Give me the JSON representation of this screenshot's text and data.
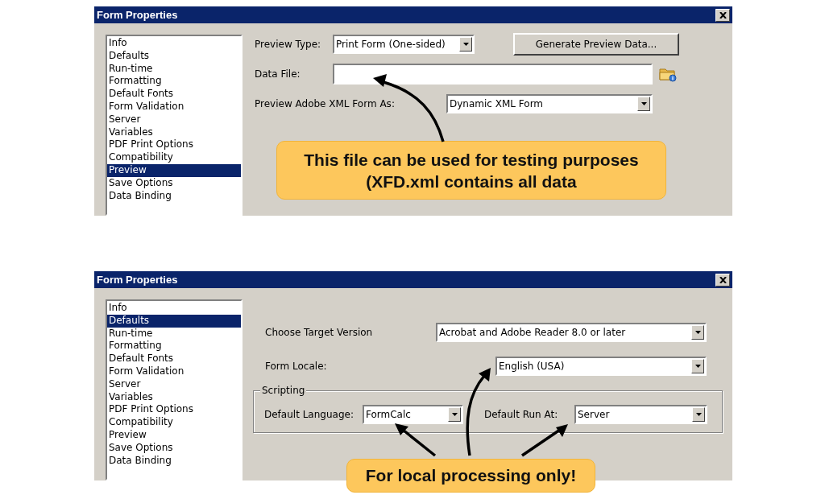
{
  "dialogs": [
    {
      "title": "Form Properties",
      "categories": [
        {
          "label": "Info",
          "selected": false
        },
        {
          "label": "Defaults",
          "selected": false
        },
        {
          "label": "Run-time",
          "selected": false
        },
        {
          "label": "Formatting",
          "selected": false
        },
        {
          "label": "Default Fonts",
          "selected": false
        },
        {
          "label": "Form Validation",
          "selected": false
        },
        {
          "label": "Server",
          "selected": false
        },
        {
          "label": "Variables",
          "selected": false
        },
        {
          "label": "PDF Print Options",
          "selected": false
        },
        {
          "label": "Compatibility",
          "selected": false
        },
        {
          "label": "Preview",
          "selected": true
        },
        {
          "label": "Save Options",
          "selected": false
        },
        {
          "label": "Data Binding",
          "selected": false
        }
      ],
      "rows": [
        {
          "kind": "row",
          "items": [
            {
              "kind": "label",
              "text": "Preview Type:"
            },
            {
              "kind": "select",
              "value": "Print Form (One-sided)"
            },
            {
              "kind": "button",
              "text": "Generate Preview Data..."
            }
          ]
        },
        {
          "kind": "row",
          "items": [
            {
              "kind": "label",
              "text": "Data File:"
            },
            {
              "kind": "input",
              "value": ""
            },
            {
              "kind": "browse"
            }
          ]
        },
        {
          "kind": "row",
          "items": [
            {
              "kind": "label",
              "text": "Preview Adobe XML Form As:"
            },
            {
              "kind": "select",
              "value": "Dynamic XML Form"
            }
          ]
        }
      ]
    },
    {
      "title": "Form Properties",
      "categories": [
        {
          "label": "Info",
          "selected": false
        },
        {
          "label": "Defaults",
          "selected": true
        },
        {
          "label": "Run-time",
          "selected": false
        },
        {
          "label": "Formatting",
          "selected": false
        },
        {
          "label": "Default Fonts",
          "selected": false
        },
        {
          "label": "Form Validation",
          "selected": false
        },
        {
          "label": "Server",
          "selected": false
        },
        {
          "label": "Variables",
          "selected": false
        },
        {
          "label": "PDF Print Options",
          "selected": false
        },
        {
          "label": "Compatibility",
          "selected": false
        },
        {
          "label": "Preview",
          "selected": false
        },
        {
          "label": "Save Options",
          "selected": false
        },
        {
          "label": "Data Binding",
          "selected": false
        }
      ],
      "rows": [
        {
          "kind": "row",
          "items": [
            {
              "kind": "label",
              "text": "Choose Target Version"
            },
            {
              "kind": "select",
              "value": "Acrobat and Adobe Reader 8.0 or later"
            }
          ]
        },
        {
          "kind": "row",
          "items": [
            {
              "kind": "label",
              "text": "Form Locale:"
            },
            {
              "kind": "select",
              "value": "English (USA)"
            }
          ]
        },
        {
          "kind": "group",
          "legend": "Scripting",
          "items": [
            {
              "kind": "label",
              "text": "Default Language:"
            },
            {
              "kind": "select",
              "value": "FormCalc"
            },
            {
              "kind": "label",
              "text": "Default Run At:"
            },
            {
              "kind": "select",
              "value": "Server"
            }
          ]
        }
      ]
    }
  ],
  "callouts": [
    {
      "text": "This file can be used for testing purposes (XFD.xml contains all data"
    },
    {
      "text": "For local processing only!"
    }
  ]
}
